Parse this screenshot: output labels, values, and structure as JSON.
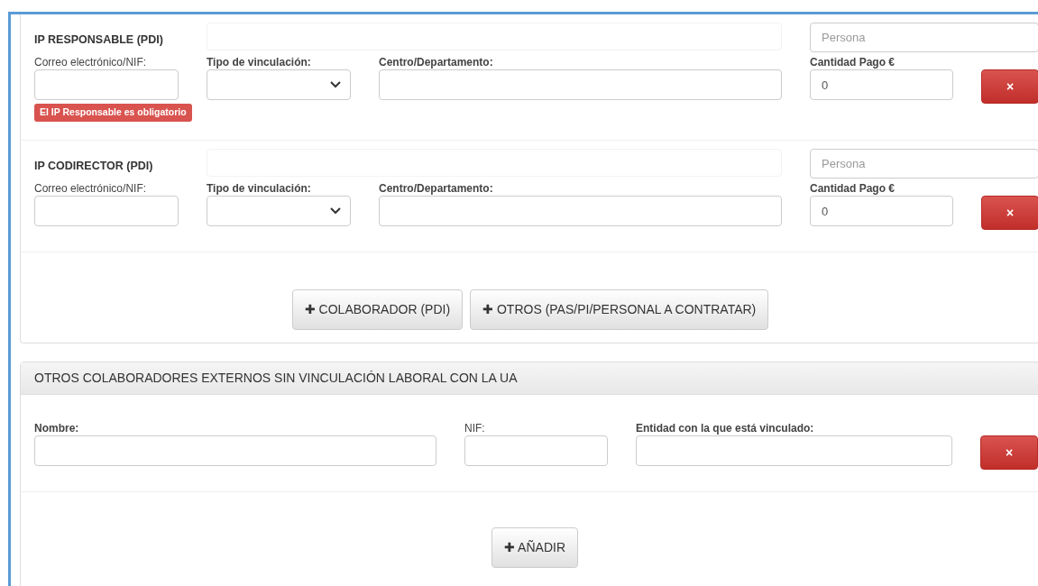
{
  "personnel": [
    {
      "title": "IP RESPONSABLE (PDI)",
      "persona_placeholder": "Persona",
      "labels": [
        "Correo electrónico/NIF:",
        "Tipo de vinculación:",
        "Centro/Departamento:",
        "Cantidad Pago €"
      ],
      "amount": "0",
      "remove": "×",
      "error": "El IP Responsable es obligatorio"
    },
    {
      "title": "IP CODIRECTOR (PDI)",
      "persona_placeholder": "Persona",
      "labels": [
        "Correo electrónico/NIF:",
        "Tipo de vinculación:",
        "Centro/Departamento:",
        "Cantidad Pago €"
      ],
      "amount": "0",
      "remove": "×"
    }
  ],
  "add_buttons": [
    {
      "icon": "✚",
      "label": "COLABORADOR (PDI)"
    },
    {
      "icon": "✚",
      "label": "OTROS (PAS/PI/PERSONAL A CONTRATAR)"
    }
  ],
  "external": {
    "title": "OTROS COLABORADORES EXTERNOS SIN VINCULACIÓN LABORAL CON LA UA",
    "labels": [
      "Nombre:",
      "NIF:",
      "Entidad con la que está vinculado:"
    ],
    "remove": "×",
    "add_button": {
      "icon": "✚",
      "label": "AÑADIR"
    }
  }
}
